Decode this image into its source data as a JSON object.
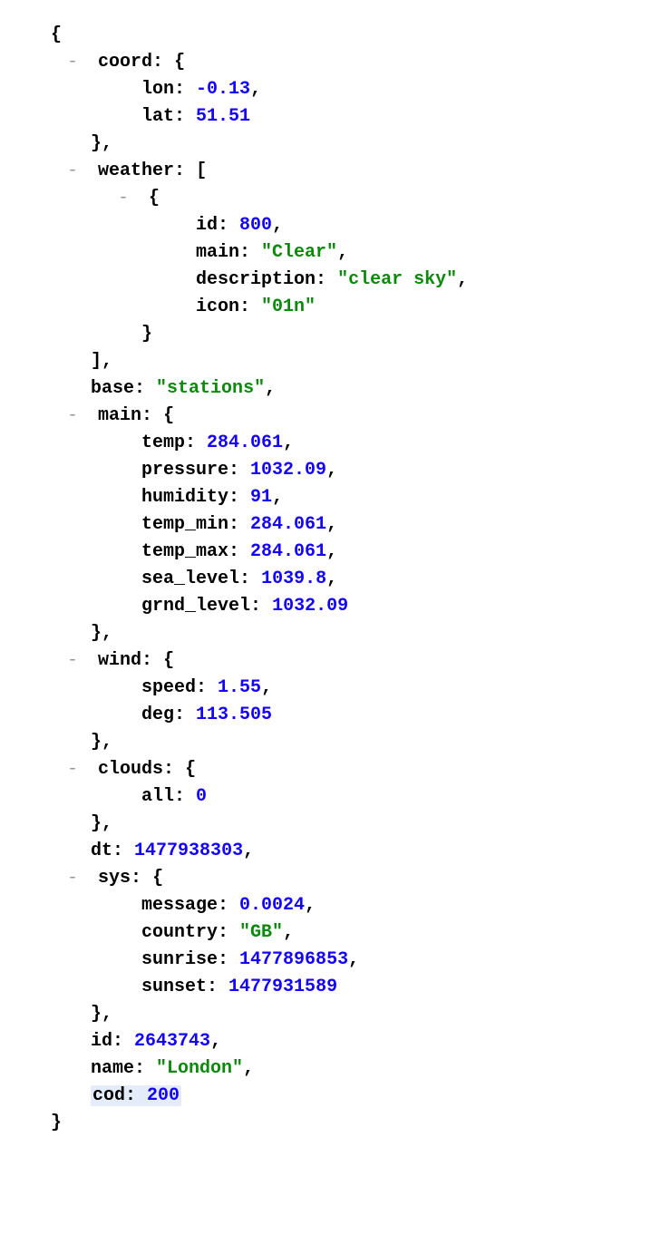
{
  "glyphs": {
    "collapse": "-",
    "obj_open": "{",
    "obj_close": "}",
    "arr_open": "[",
    "arr_close": "]",
    "colon": ":",
    "comma": ","
  },
  "keys": {
    "coord": "coord",
    "lon": "lon",
    "lat": "lat",
    "weather": "weather",
    "id": "id",
    "main_key": "main",
    "description": "description",
    "icon": "icon",
    "base": "base",
    "main_obj": "main",
    "temp": "temp",
    "pressure": "pressure",
    "humidity": "humidity",
    "temp_min": "temp_min",
    "temp_max": "temp_max",
    "sea_level": "sea_level",
    "grnd_level": "grnd_level",
    "wind": "wind",
    "speed": "speed",
    "deg": "deg",
    "clouds": "clouds",
    "all": "all",
    "dt": "dt",
    "sys": "sys",
    "message": "message",
    "country": "country",
    "sunrise": "sunrise",
    "sunset": "sunset",
    "root_id": "id",
    "name": "name",
    "cod": "cod"
  },
  "values": {
    "lon": "-0.13",
    "lat": "51.51",
    "weather_id": "800",
    "weather_main": "\"Clear\"",
    "weather_desc": "\"clear sky\"",
    "weather_icon": "\"01n\"",
    "base": "\"stations\"",
    "temp": "284.061",
    "pressure": "1032.09",
    "humidity": "91",
    "temp_min": "284.061",
    "temp_max": "284.061",
    "sea_level": "1039.8",
    "grnd_level": "1032.09",
    "speed": "1.55",
    "deg": "113.505",
    "all": "0",
    "dt": "1477938303",
    "message": "0.0024",
    "country": "\"GB\"",
    "sunrise": "1477896853",
    "sunset": "1477931589",
    "root_id": "2643743",
    "name": "\"London\"",
    "cod": "200"
  }
}
